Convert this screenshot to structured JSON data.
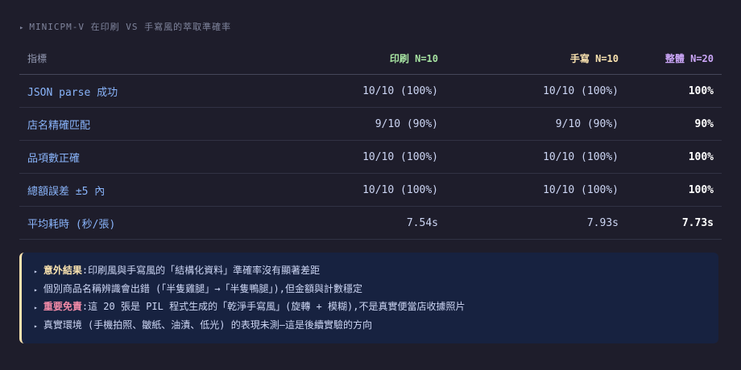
{
  "caption": {
    "arrow": "▸",
    "text": "MINICPM-V 在印刷 VS 手寫風的萃取準確率"
  },
  "table": {
    "columns": [
      {
        "label": "指標",
        "color": "#9399b2"
      },
      {
        "label": "印刷 N=10",
        "color": "#a6e3a1"
      },
      {
        "label": "手寫 N=10",
        "color": "#f9e2af"
      },
      {
        "label": "整體 N=20",
        "color": "#cba6f7"
      }
    ],
    "rows": [
      {
        "metric": "JSON parse 成功",
        "print": "10/10 (100%)",
        "handwritten": "10/10 (100%)",
        "overall": "100%"
      },
      {
        "metric": "店名精確匹配",
        "print": "9/10 (90%)",
        "handwritten": "9/10 (90%)",
        "overall": "90%"
      },
      {
        "metric": "品項數正確",
        "print": "10/10 (100%)",
        "handwritten": "10/10 (100%)",
        "overall": "100%"
      },
      {
        "metric": "總額誤差 ±5 內",
        "print": "10/10 (100%)",
        "handwritten": "10/10 (100%)",
        "overall": "100%"
      },
      {
        "metric": "平均耗時 (秒/張)",
        "print": "7.54s",
        "handwritten": "7.93s",
        "overall": "7.73s"
      }
    ]
  },
  "notes": {
    "bullet": "▸",
    "items": [
      {
        "label": "意外結果",
        "label_color": "yellow",
        "text": ":印刷風與手寫風的「結構化資料」準確率沒有顯著差距"
      },
      {
        "label": "",
        "label_color": "",
        "text": "個別商品名稱辨識會出錯 (「半隻雞腿」→「半隻鴨腿」),但金額與計數穩定"
      },
      {
        "label": "重要免責",
        "label_color": "red",
        "text": ":這 20 張是 PIL 程式生成的「乾淨手寫風」(旋轉 + 模糊),不是真實便當店收據照片"
      },
      {
        "label": "",
        "label_color": "",
        "text": "真實環境 (手機拍照、皺紙、油漬、低光) 的表現未測—這是後續實驗的方向"
      }
    ]
  }
}
